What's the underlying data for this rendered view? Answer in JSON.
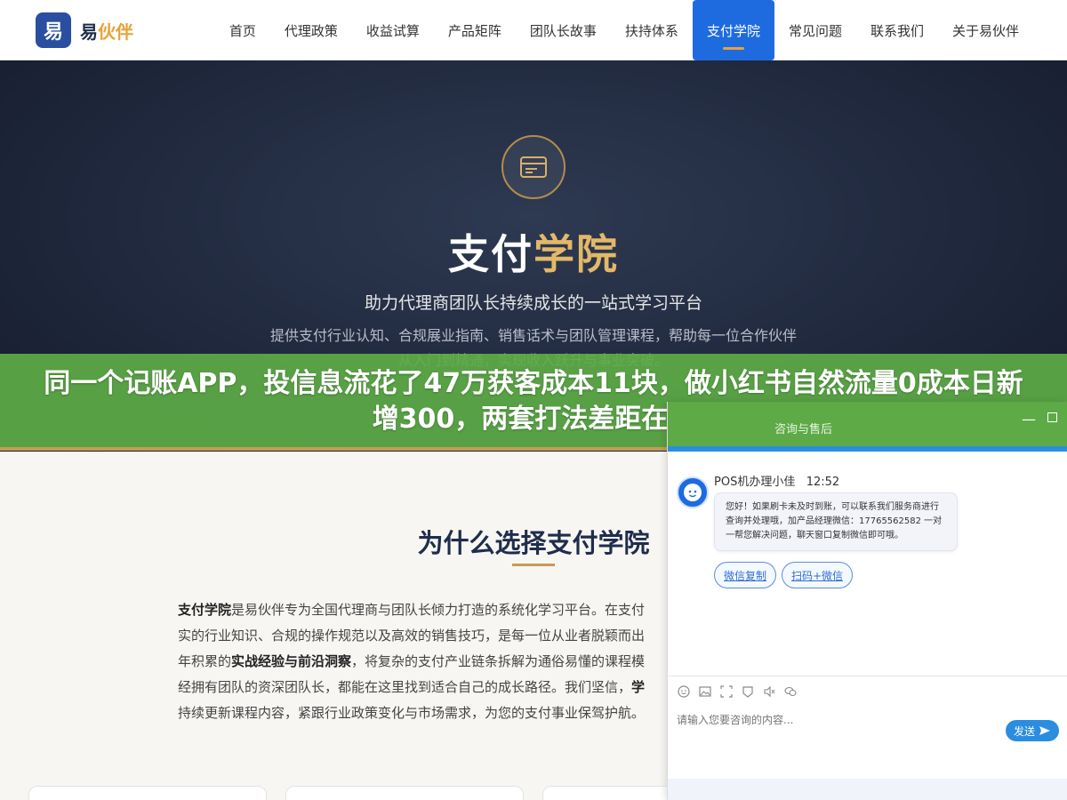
{
  "brand": {
    "mark": "易",
    "name_prefix": "易",
    "name_accent": "伙伴"
  },
  "nav": {
    "items": [
      {
        "label": "首页"
      },
      {
        "label": "代理政策"
      },
      {
        "label": "收益试算"
      },
      {
        "label": "产品矩阵"
      },
      {
        "label": "团队长故事"
      },
      {
        "label": "扶持体系"
      },
      {
        "label": "支付学院",
        "active": true
      },
      {
        "label": "常见问题"
      },
      {
        "label": "联系我们"
      },
      {
        "label": "关于易伙伴"
      }
    ]
  },
  "hero": {
    "icon": "card-window-icon",
    "title_white": "支付",
    "title_accent": "学院",
    "subtitle": "助力代理商团队长持续成长的一站式学习平台",
    "description": "提供支付行业认知、合规展业指南、销售话术与团队管理课程，帮助每一位合作伙伴从入门到精通，实现收入跃升与事业突破。"
  },
  "banner": {
    "text": "同一个记账APP，投信息流花了47万获客成本11块，做小红书自然流量0成本日新增300，两套打法差距在哪"
  },
  "section": {
    "title": "为什么选择支付学院",
    "p1_bold": "支付学院",
    "p1": "是易伙伴专为全国代理商与团队长倾力打造的系统化学习平台。在支付",
    "p2": "实的行业知识、合规的操作规范以及高效的销售技巧，是每一位从业者脱颖而出",
    "p3_a": "年积累的",
    "p3_bold": "实战经验与前沿洞察",
    "p3_b": "，将复杂的支付产业链条拆解为通俗易懂的课程模",
    "p4_a": "经拥有团队的资深团队长，都能在这里找到适合自己的成长路径。我们坚信，",
    "p4_bold": "学",
    "p5": "持续更新课程内容，紧跟行业政策变化与市场需求，为您的支付事业保驾护航。"
  },
  "chat": {
    "header_title": "咨询与售后",
    "agent_name": "POS机办理小佳",
    "time": "12:52",
    "message": "您好！如果刷卡未及时到账，可以联系我们服务商进行查询并处理哦，加产品经理微信：17765562582 一对一帮您解决问题，聊天窗口复制微信即可哦。",
    "quick_replies": [
      "微信复制",
      "扫码+微信"
    ],
    "input_placeholder": "请输入您要咨询的内容...",
    "send_label": "发送",
    "colors": {
      "header": "#5daa46",
      "accent": "#2a8de0"
    }
  }
}
